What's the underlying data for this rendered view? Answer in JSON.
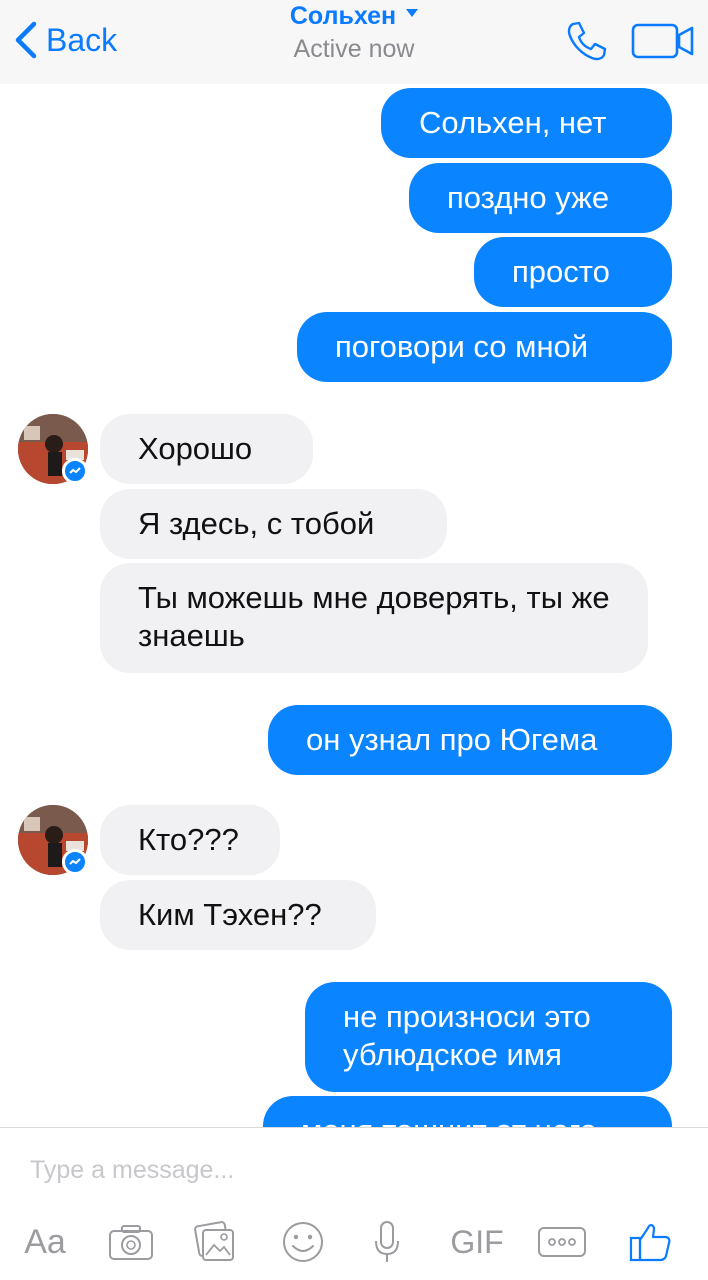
{
  "header": {
    "back_label": "Back",
    "title": "Сольхен",
    "subtitle": "Active now",
    "accent": "#0a7bff"
  },
  "messages": [
    {
      "from": "me",
      "text": "Сольхен, нет"
    },
    {
      "from": "me",
      "text": "поздно уже"
    },
    {
      "from": "me",
      "text": "просто"
    },
    {
      "from": "me",
      "text": "поговори со мной"
    },
    {
      "from": "them",
      "text": "Хорошо"
    },
    {
      "from": "them",
      "text": "Я здесь, с тобой"
    },
    {
      "from": "them",
      "text": "Ты можешь мне доверять, ты же знаешь"
    },
    {
      "from": "me",
      "text": "он узнал про Югема"
    },
    {
      "from": "them",
      "text": "Кто???"
    },
    {
      "from": "them",
      "text": "Ким Тэхен??"
    },
    {
      "from": "me",
      "text": "не произноси это ублюдское имя"
    },
    {
      "from": "me",
      "text": "меня тошнит от него"
    }
  ],
  "composer": {
    "placeholder": "Type a message...",
    "aa_label": "Aa",
    "gif_label": "GIF"
  },
  "icons": [
    "back-chevron-icon",
    "phone-icon",
    "video-camera-icon",
    "messenger-badge-icon",
    "camera-icon",
    "photo-gallery-icon",
    "emoji-icon",
    "microphone-icon",
    "more-options-icon",
    "thumbs-up-icon"
  ],
  "colors": {
    "outgoing_bubble": "#0a84ff",
    "incoming_bubble": "#f1f0f3",
    "toolbar_icon": "#9b9ba0"
  }
}
